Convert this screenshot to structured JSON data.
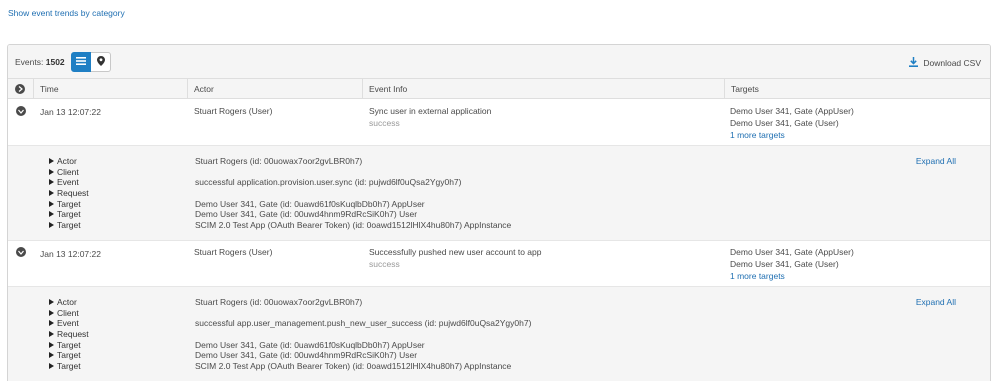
{
  "trend_link": "Show event trends by category",
  "toolbar": {
    "events_label": "Events:",
    "events_count": "1502",
    "download_label": "Download CSV"
  },
  "columns": [
    "Time",
    "Actor",
    "Event Info",
    "Targets"
  ],
  "events": [
    {
      "time": "Jan 13 12:07:22",
      "actor": "Stuart Rogers  (User)",
      "event_title": "Sync user in external application",
      "event_status": "success",
      "targets": [
        "Demo User 341, Gate  (AppUser)",
        "Demo User 341, Gate  (User)"
      ],
      "more_targets": "1 more targets",
      "detail": {
        "labels": [
          "Actor",
          "Client",
          "Event",
          "Request",
          "Target",
          "Target",
          "Target"
        ],
        "values": [
          "Stuart Rogers (id: 00uowax7oor2gvLBR0h7)",
          "",
          "successful application.provision.user.sync (id: pujwd6lf0uQsa2Ygy0h7)",
          "",
          "Demo User 341, Gate (id: 0uawd61f0sKuqlbDb0h7) AppUser",
          "Demo User 341, Gate (id: 00uwd4hnm9RdRcSiK0h7) User",
          "SCIM 2.0 Test App (OAuth Bearer Token) (id: 0oawd1512lHlX4hu80h7) AppInstance"
        ],
        "expand_all": "Expand All"
      }
    },
    {
      "time": "Jan 13 12:07:22",
      "actor": "Stuart Rogers  (User)",
      "event_title": "Successfully pushed new user account to app",
      "event_status": "success",
      "targets": [
        "Demo User 341, Gate  (AppUser)",
        "Demo User 341, Gate  (User)"
      ],
      "more_targets": "1 more targets",
      "detail": {
        "labels": [
          "Actor",
          "Client",
          "Event",
          "Request",
          "Target",
          "Target",
          "Target"
        ],
        "values": [
          "Stuart Rogers (id: 00uowax7oor2gvLBR0h7)",
          "",
          "successful app.user_management.push_new_user_success (id: pujwd6lf0uQsa2Ygy0h7)",
          "",
          "Demo User 341, Gate (id: 0uawd61f0sKuqlbDb0h7) AppUser",
          "Demo User 341, Gate (id: 00uwd4hnm9RdRcSiK0h7) User",
          "SCIM 2.0 Test App (OAuth Bearer Token) (id: 0oawd1512lHlX4hu80h7) AppInstance"
        ],
        "expand_all": "Expand All"
      }
    }
  ],
  "colors": {
    "accent": "#1f7fc4",
    "link": "#1f6fb2",
    "header_bg": "#f5f5f5"
  }
}
